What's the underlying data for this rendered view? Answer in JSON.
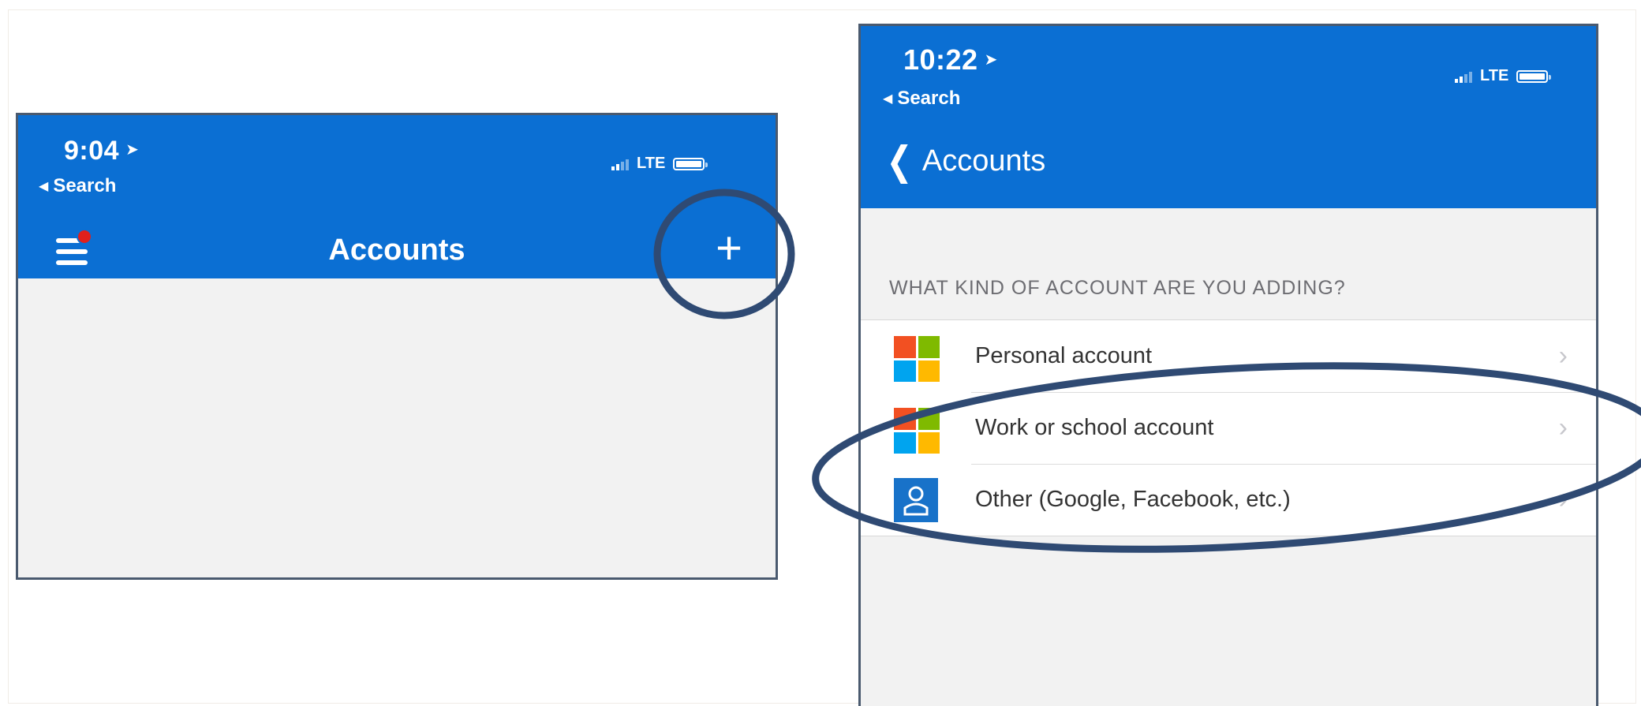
{
  "colors": {
    "nav_blue": "#0b6fd3",
    "annotation_circle": "#2f4a73",
    "notification_dot": "#e0201c",
    "ms_red": "#f25022",
    "ms_green": "#7fba00",
    "ms_blue": "#00a4ef",
    "ms_yellow": "#ffb900"
  },
  "left_phone": {
    "status_time": "9:04",
    "back_label": "Search",
    "network": "LTE",
    "title": "Accounts",
    "menu_icon": "hamburger-menu-icon",
    "add_icon": "plus-icon",
    "add_symbol": "+"
  },
  "right_phone": {
    "status_time": "10:22",
    "back_label": "Search",
    "network": "LTE",
    "nav_back_label": "Accounts",
    "section_header": "WHAT KIND OF ACCOUNT ARE YOU ADDING?",
    "items": [
      {
        "label": "Personal account",
        "icon": "microsoft-logo-icon"
      },
      {
        "label": "Work or school account",
        "icon": "microsoft-logo-icon"
      },
      {
        "label": "Other (Google, Facebook, etc.)",
        "icon": "person-icon"
      }
    ]
  }
}
